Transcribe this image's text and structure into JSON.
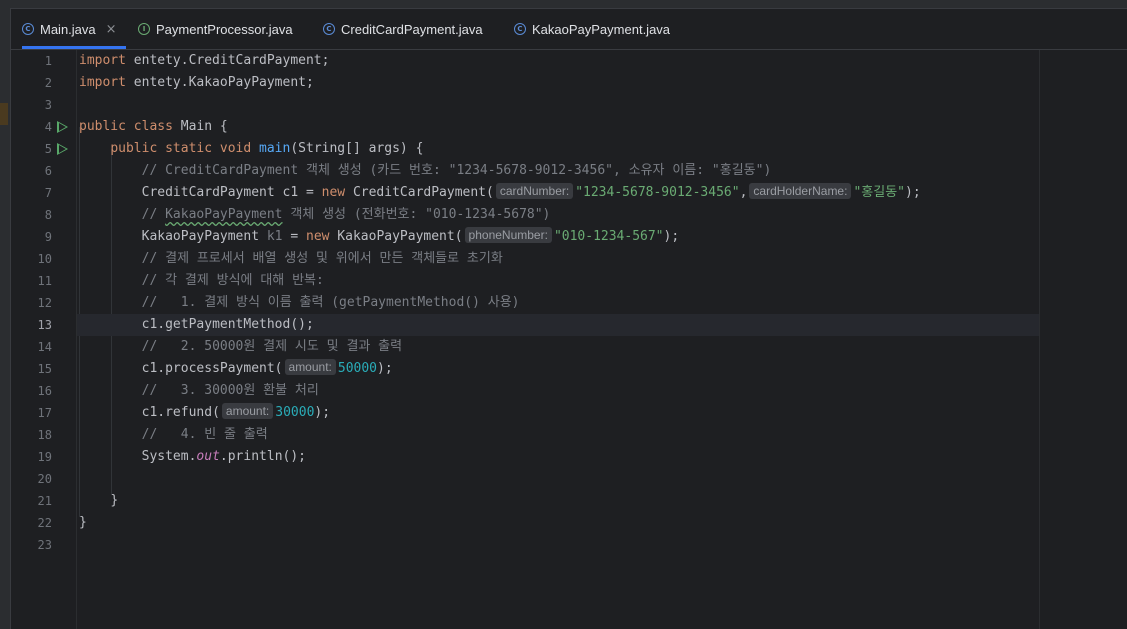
{
  "tabs": [
    {
      "label": "Main.java",
      "icon": "main-class-icon",
      "active": true
    },
    {
      "label": "PaymentProcessor.java",
      "icon": "interface-icon"
    },
    {
      "label": "CreditCardPayment.java",
      "icon": "class-icon"
    },
    {
      "label": "KakaoPayPayment.java",
      "icon": "class-icon"
    }
  ],
  "close_glyph": "×",
  "current_line": 13,
  "line_numbers": [
    "1",
    "2",
    "3",
    "4",
    "5",
    "6",
    "7",
    "8",
    "9",
    "10",
    "11",
    "12",
    "13",
    "14",
    "15",
    "16",
    "17",
    "18",
    "19",
    "20",
    "21",
    "22",
    "23"
  ],
  "code": {
    "l1": {
      "kw": "import",
      "rest": " entety.CreditCardPayment;"
    },
    "l2": {
      "kw": "import",
      "rest": " entety.KakaoPayPayment;"
    },
    "l4": {
      "kw": "public class",
      "rest": " Main {"
    },
    "l5": {
      "kw": "public static void",
      "fn": "main",
      "rest": "(String[] args) {"
    },
    "l6": {
      "cm": "// CreditCardPayment 객체 생성 (카드 번호: \"1234-5678-9012-3456\", 소유자 이름: \"홍길동\")"
    },
    "l7": {
      "pre": "CreditCardPayment c1 = ",
      "kw": "new",
      "mid": " CreditCardPayment(",
      "hint1": "cardNumber:",
      "str1": "\"1234-5678-9012-3456\"",
      "comma": ",",
      "hint2": "cardHolderName:",
      "str2": "\"홍길동\"",
      "post": ");"
    },
    "l8": {
      "cm1": "// ",
      "cm_wavy": "KakaoPayPayment",
      "cm2": " 객체 생성 (전화번호: \"010-1234-5678\")"
    },
    "l9": {
      "pre": "KakaoPayPayment ",
      "var": "k1",
      "eq": " = ",
      "kw": "new",
      "mid": " KakaoPayPayment(",
      "hint": "phoneNumber:",
      "str": "\"010-1234-567\"",
      "post": ");"
    },
    "l10": {
      "cm": "// 결제 프로세서 배열 생성 및 위에서 만든 객체들로 초기화"
    },
    "l11": {
      "cm": "// 각 결제 방식에 대해 반복:"
    },
    "l12": {
      "cm": "//   1. 결제 방식 이름 출력 (getPaymentMethod() 사용)"
    },
    "l13": {
      "text": "c1.getPaymentMethod();"
    },
    "l14": {
      "cm": "//   2. 50000원 결제 시도 및 결과 출력"
    },
    "l15": {
      "pre": "c1.processPayment(",
      "hint": "amount:",
      "num": "50000",
      "post": ");"
    },
    "l16": {
      "cm": "//   3. 30000원 환불 처리"
    },
    "l17": {
      "pre": "c1.refund(",
      "hint": "amount:",
      "num": "30000",
      "post": ");"
    },
    "l18": {
      "cm": "//   4. 빈 줄 출력"
    },
    "l19": {
      "pre": "System.",
      "st": "out",
      "post": ".println();"
    },
    "l21": {
      "text": "}"
    },
    "l22": {
      "text": "}"
    }
  },
  "colors": {
    "background": "#1e1f22",
    "keyword": "#cf8e6d",
    "function": "#56a8f5",
    "string": "#6aab73",
    "number": "#2aacb8",
    "comment": "#7a7e85",
    "active_tab_underline": "#3574f0"
  }
}
